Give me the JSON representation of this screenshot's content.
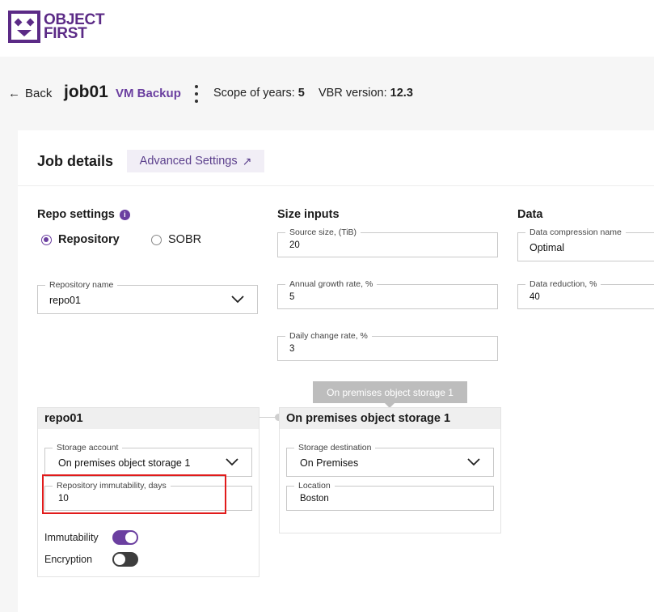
{
  "logo": {
    "line1": "OBJECT",
    "line2": "FIRST",
    "brand_color": "#5b2a86"
  },
  "header": {
    "back_label": "Back",
    "back_icon": "arrow-left-icon",
    "job_name": "job01",
    "job_type": "VM Backup",
    "scope_label": "Scope of years:",
    "scope_value": "5",
    "vbr_label": "VBR version:",
    "vbr_value": "12.3"
  },
  "job_details": {
    "title": "Job details",
    "advanced_label": "Advanced Settings",
    "advanced_icon": "external-arrow-icon"
  },
  "repo_settings": {
    "title": "Repo settings",
    "info_icon": "info-icon",
    "radio_options": [
      {
        "label": "Repository",
        "selected": true
      },
      {
        "label": "SOBR",
        "selected": false
      }
    ],
    "repository_name": {
      "label": "Repository name",
      "value": "repo01"
    }
  },
  "size_inputs": {
    "title": "Size inputs",
    "source_size": {
      "label": "Source size, (TiB)",
      "value": "20"
    },
    "annual_growth": {
      "label": "Annual growth rate, %",
      "value": "5"
    },
    "daily_change": {
      "label": "Daily change rate, %",
      "value": "3"
    }
  },
  "data_section": {
    "title": "Data",
    "compression": {
      "label": "Data compression name",
      "value": "Optimal"
    },
    "reduction": {
      "label": "Data reduction, %",
      "value": "40"
    }
  },
  "repo_panel": {
    "title": "repo01",
    "storage_account": {
      "label": "Storage account",
      "value": "On premises object storage 1"
    },
    "immutability_days": {
      "label": "Repository immutability, days",
      "value": "10"
    },
    "immutability_label": "Immutability",
    "immutability_on": true,
    "encryption_label": "Encryption",
    "encryption_on": false
  },
  "storage_panel": {
    "tooltip": "On premises object storage 1",
    "title": "On premises object storage 1",
    "destination": {
      "label": "Storage destination",
      "value": "On Premises"
    },
    "location": {
      "label": "Location",
      "value": "Boston"
    }
  },
  "colors": {
    "accent": "#6b3fa0",
    "highlight": "#e11b1b"
  }
}
